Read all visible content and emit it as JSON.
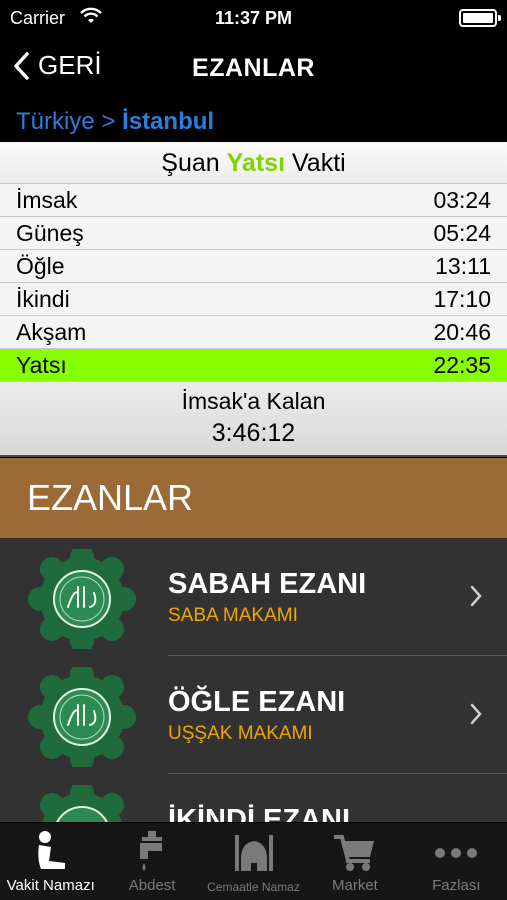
{
  "status_bar": {
    "carrier": "Carrier",
    "time": "11:37 PM"
  },
  "nav": {
    "back_label": "GERİ",
    "title": "EZANLAR"
  },
  "breadcrumb": {
    "country": "Türkiye",
    "separator": ">",
    "city": "İstanbul"
  },
  "current": {
    "prefix": "Şuan",
    "name": "Yatsı",
    "suffix": "Vakti"
  },
  "times": [
    {
      "name": "İmsak",
      "time": "03:24"
    },
    {
      "name": "Güneş",
      "time": "05:24"
    },
    {
      "name": "Öğle",
      "time": "13:11"
    },
    {
      "name": "İkindi",
      "time": "17:10"
    },
    {
      "name": "Akşam",
      "time": "20:46"
    },
    {
      "name": "Yatsı",
      "time": "22:35"
    }
  ],
  "remaining": {
    "label": "İmsak'a Kalan",
    "value": "3:46:12"
  },
  "section": {
    "title": "EZANLAR"
  },
  "ezans": [
    {
      "name": "SABAH EZANI",
      "makam": "SABA MAKAMI"
    },
    {
      "name": "ÖĞLE EZANI",
      "makam": "UŞŞAK MAKAMI"
    },
    {
      "name": "İKİNDİ EZANI",
      "makam": ""
    }
  ],
  "tabs": [
    {
      "label": "Vakit Namazı",
      "icon": "praying-person-icon"
    },
    {
      "label": "Abdest",
      "icon": "faucet-icon"
    },
    {
      "label": "Cemaatle Namaz",
      "icon": "mosque-icon"
    },
    {
      "label": "Market",
      "icon": "cart-icon"
    },
    {
      "label": "Fazlası",
      "icon": "more-dots-icon"
    }
  ],
  "colors": {
    "active_row": "#88ff00",
    "current_name": "#7ed300",
    "section_bg": "#9c6a36",
    "makam": "#f0a500",
    "breadcrumb": "#2b7fd8"
  }
}
